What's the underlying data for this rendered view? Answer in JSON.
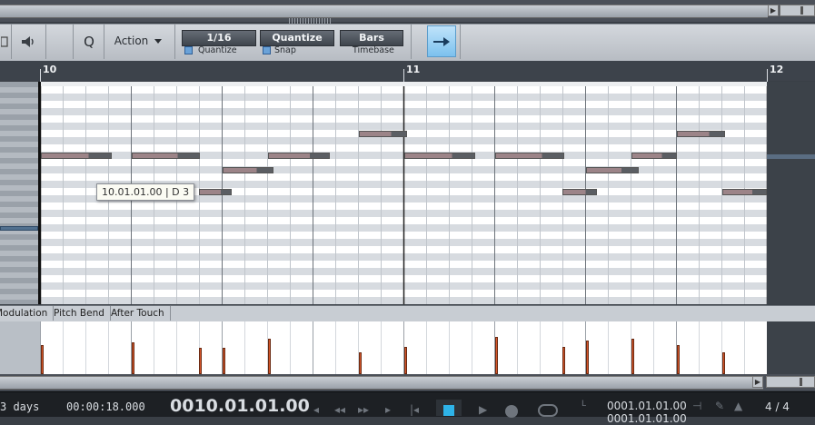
{
  "toolbar": {
    "action_label": "Action",
    "quantize_value": "1/16",
    "quantize_mode": "Quantize",
    "timebase_value": "Bars",
    "quantize_label": "Quantize",
    "snap_label": "Snap",
    "timebase_label": "Timebase"
  },
  "ruler": {
    "bars": [
      "10",
      "11",
      "12"
    ]
  },
  "tooltip": "10.01.01.00 | D 3",
  "lanes": {
    "tabs": [
      "Modulation",
      "Pitch Bend",
      "After Touch"
    ]
  },
  "velocities": [
    0.55,
    0.6,
    0.5,
    0.5,
    0.68,
    0.42,
    0.52,
    0.7,
    0.52,
    0.64,
    0.68,
    0.55,
    0.42
  ],
  "transport": {
    "duration": "3 days",
    "seconds": "00:00:18.000",
    "position": "0010.01.01.00",
    "loop_start": "0001.01.01.00",
    "loop_end": "0001.01.01.00",
    "time_signature": "4 / 4"
  },
  "colors": {
    "accent": "#7cc1ee",
    "note": "#9c8488",
    "velocity": "#d9572b"
  }
}
